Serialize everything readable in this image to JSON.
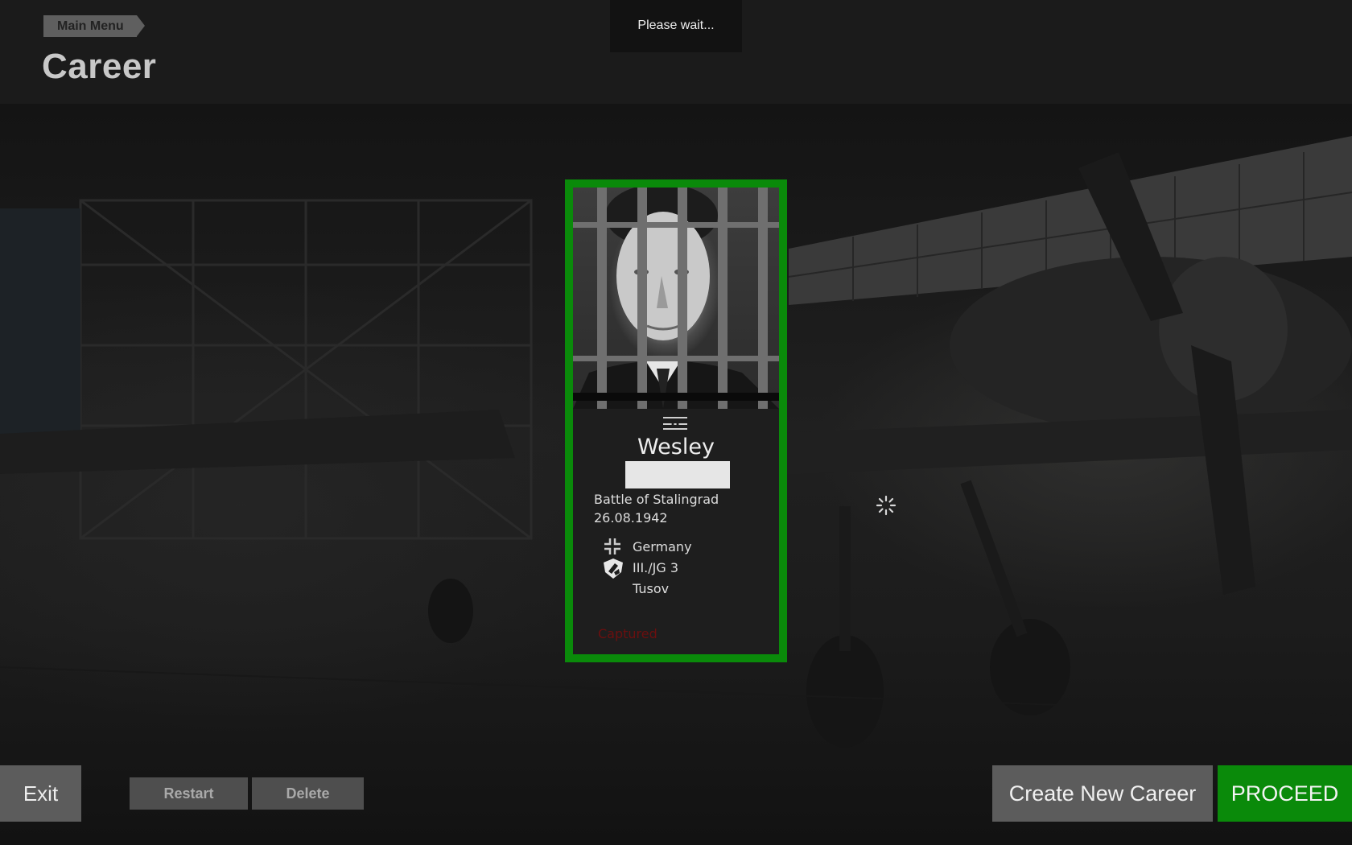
{
  "header": {
    "breadcrumb": "Main Menu",
    "title": "Career"
  },
  "notice": "Please wait...",
  "card": {
    "name": "Wesley",
    "campaign": "Battle of Stalingrad",
    "date": "26.08.1942",
    "country": "Germany",
    "unit": "III./JG 3",
    "location": "Tusov",
    "status": "Captured",
    "accent_color": "#0a8a0a",
    "status_color": "#6b0f0f",
    "icons": [
      "rank-icon",
      "country-balkenkreuz-icon",
      "unit-emblem-icon"
    ]
  },
  "loading_indicator": "spinner-icon",
  "buttons": {
    "exit": "Exit",
    "restart": "Restart",
    "delete": "Delete",
    "create_new_career": "Create New Career",
    "proceed": "PROCEED"
  }
}
